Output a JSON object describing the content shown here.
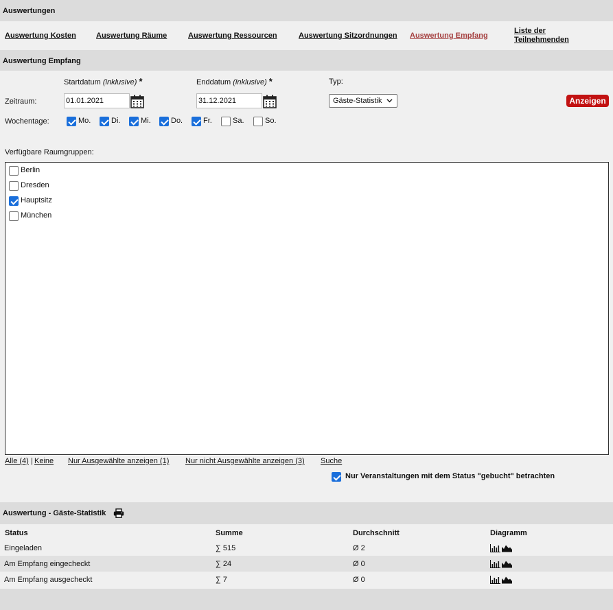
{
  "header": {
    "title": "Auswertungen"
  },
  "nav": [
    {
      "label": "Auswertung Kosten",
      "active": false
    },
    {
      "label": "Auswertung Räume",
      "active": false
    },
    {
      "label": "Auswertung Ressourcen",
      "active": false
    },
    {
      "label": "Auswertung Sitzordnungen",
      "active": false
    },
    {
      "label": "Auswertung Empfang",
      "active": true
    },
    {
      "label_line1": "Liste der",
      "label_line2": "Teilnehmenden",
      "active": false
    }
  ],
  "section": {
    "title": "Auswertung Empfang"
  },
  "form": {
    "start_label": "Startdatum",
    "start_hint": "(inklusive)",
    "end_label": "Enddatum",
    "end_hint": "(inklusive)",
    "required_mark": "*",
    "type_label": "Typ:",
    "period_label": "Zeitraum:",
    "start_value": "01.01.2021",
    "end_value": "31.12.2021",
    "type_value": "Gäste-Statistik",
    "show_button": "Anzeigen",
    "weekdays_label": "Wochentage:",
    "weekdays": [
      {
        "label": "Mo.",
        "checked": true
      },
      {
        "label": "Di.",
        "checked": true
      },
      {
        "label": "Mi.",
        "checked": true
      },
      {
        "label": "Do.",
        "checked": true
      },
      {
        "label": "Fr.",
        "checked": true
      },
      {
        "label": "Sa.",
        "checked": false
      },
      {
        "label": "So.",
        "checked": false
      }
    ],
    "roomgroups_label": "Verfügbare Raumgruppen:",
    "roomgroups": [
      {
        "label": "Berlin",
        "checked": false
      },
      {
        "label": "Dresden",
        "checked": false
      },
      {
        "label": "Hauptsitz",
        "checked": true
      },
      {
        "label": "München",
        "checked": false
      }
    ],
    "links": {
      "all": "Alle (4)",
      "sep": "|",
      "none": "Keine",
      "only_selected": "Nur Ausgewählte anzeigen (1)",
      "only_unselected": "Nur nicht Ausgewählte anzeigen (3)",
      "search": "Suche"
    },
    "booked_only_label": "Nur Veranstaltungen mit dem Status \"gebucht\" betrachten",
    "booked_only_checked": true
  },
  "results": {
    "title": "Auswertung - Gäste-Statistik",
    "columns": [
      "Status",
      "Summe",
      "Durchschnitt",
      "Diagramm"
    ],
    "rows": [
      {
        "status": "Eingeladen",
        "sum": "∑ 515",
        "avg": "Ø 2"
      },
      {
        "status": "Am Empfang eingecheckt",
        "sum": "∑ 24",
        "avg": "Ø 0"
      },
      {
        "status": "Am Empfang ausgecheckt",
        "sum": "∑ 7",
        "avg": "Ø 0"
      }
    ]
  },
  "icons": {
    "calendar": "calendar-icon",
    "print": "print-icon",
    "bar_chart": "bar-chart-icon",
    "area_chart": "area-chart-icon",
    "chevron": "chevron-down-icon"
  },
  "colors": {
    "active_link": "#a54040",
    "button": "#c21212",
    "checkbox": "#1a6fdb"
  }
}
